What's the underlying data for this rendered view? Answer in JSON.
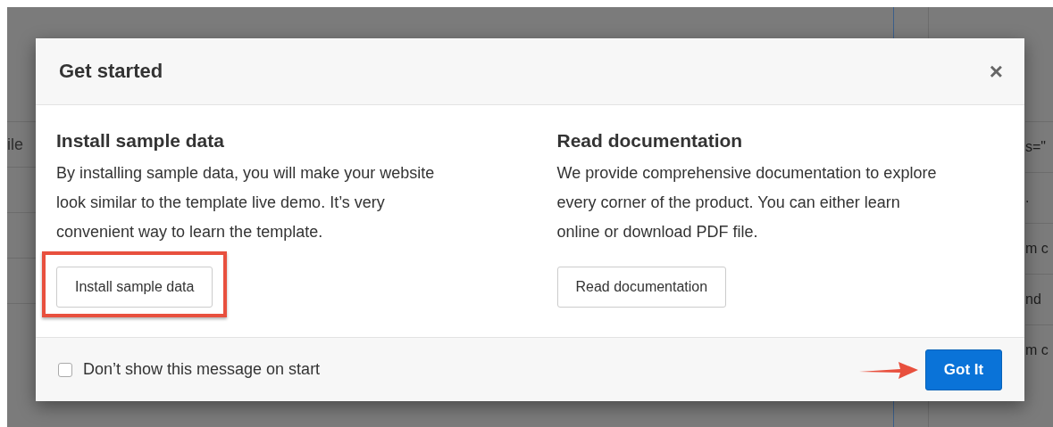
{
  "background": {
    "left_fragments": [
      "ile"
    ],
    "right_fragments": [
      "s=\"",
      ".",
      "m c",
      "nd",
      "m c"
    ]
  },
  "modal": {
    "title": "Get started",
    "close": "×",
    "sections": [
      {
        "heading": "Install sample data",
        "text": "By installing sample data, you will make your website look similar to the template live demo. It’s very convenient way to learn the template.",
        "button": "Install sample data",
        "highlighted": true
      },
      {
        "heading": "Read documentation",
        "text": "We provide comprehensive documentation to explore every corner of the product. You can either learn online or download PDF file.",
        "button": "Read documentation",
        "highlighted": false
      }
    ],
    "footer": {
      "checkbox": {
        "label": "Don’t show this message on start",
        "checked": false
      },
      "primary_button": "Got It",
      "pointer_arrow": true
    }
  }
}
